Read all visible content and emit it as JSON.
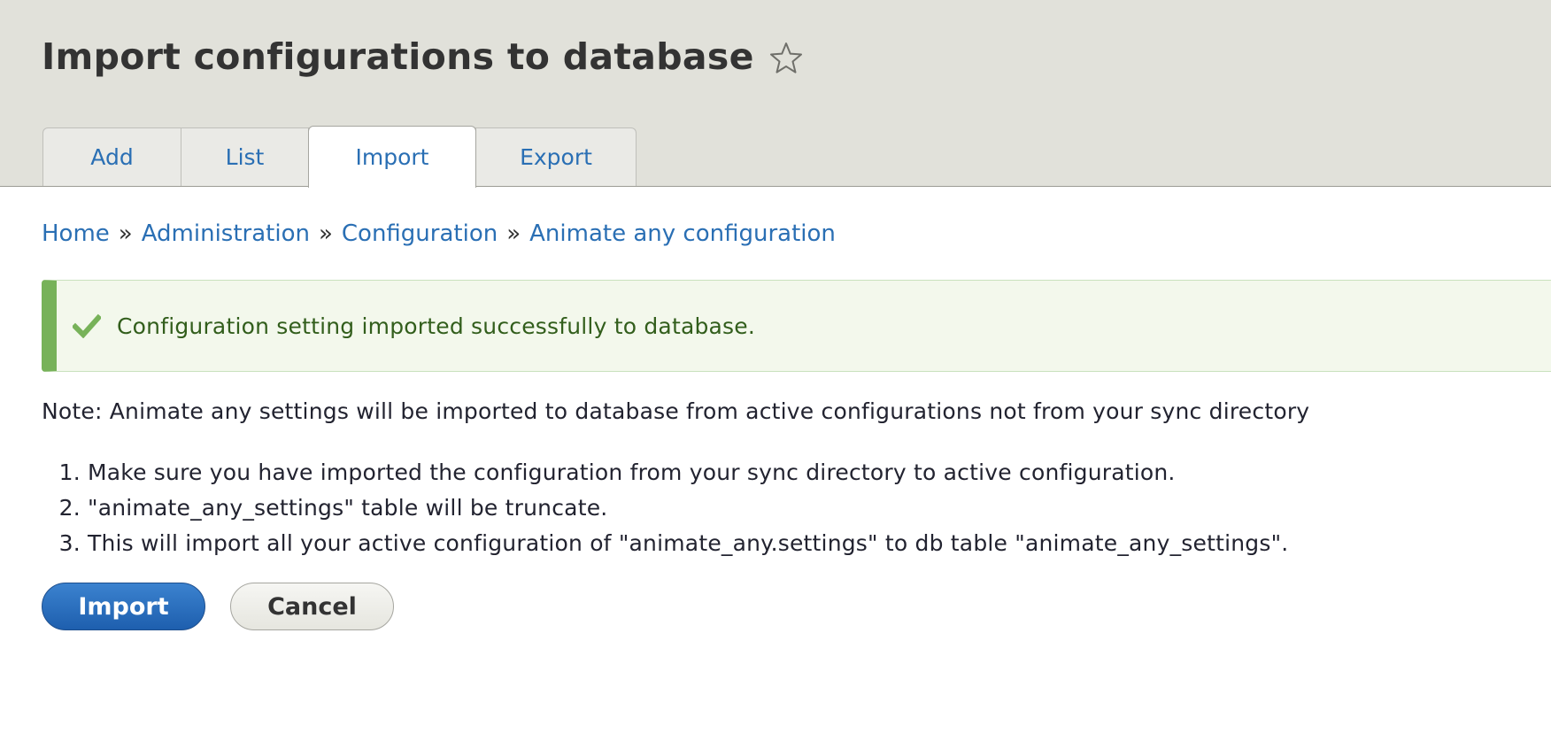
{
  "header": {
    "title": "Import configurations to database",
    "favorite_icon": "star-outline-icon"
  },
  "tabs": [
    {
      "label": "Add",
      "active": false
    },
    {
      "label": "List",
      "active": false
    },
    {
      "label": "Import",
      "active": true
    },
    {
      "label": "Export",
      "active": false
    }
  ],
  "breadcrumb": {
    "items": [
      "Home",
      "Administration",
      "Configuration",
      "Animate any configuration"
    ],
    "separator": "»"
  },
  "status_message": {
    "icon": "checkmark-icon",
    "text": "Configuration setting imported successfully to database."
  },
  "note": "Note: Animate any settings will be imported to database from active configurations not from your sync directory",
  "steps": [
    "Make sure you have imported the configuration from your sync directory to active configuration.",
    "\"animate_any_settings\" table will be truncate.",
    "This will import all your active configuration of \"animate_any.settings\" to db table \"animate_any_settings\"."
  ],
  "actions": {
    "import_label": "Import",
    "cancel_label": "Cancel"
  },
  "colors": {
    "header_bg": "#e1e1da",
    "link": "#2a6fb4",
    "success_border": "#77b259",
    "success_bg": "#f3f8ec",
    "success_text": "#325e1c",
    "primary_button": "#2a6fb4"
  }
}
